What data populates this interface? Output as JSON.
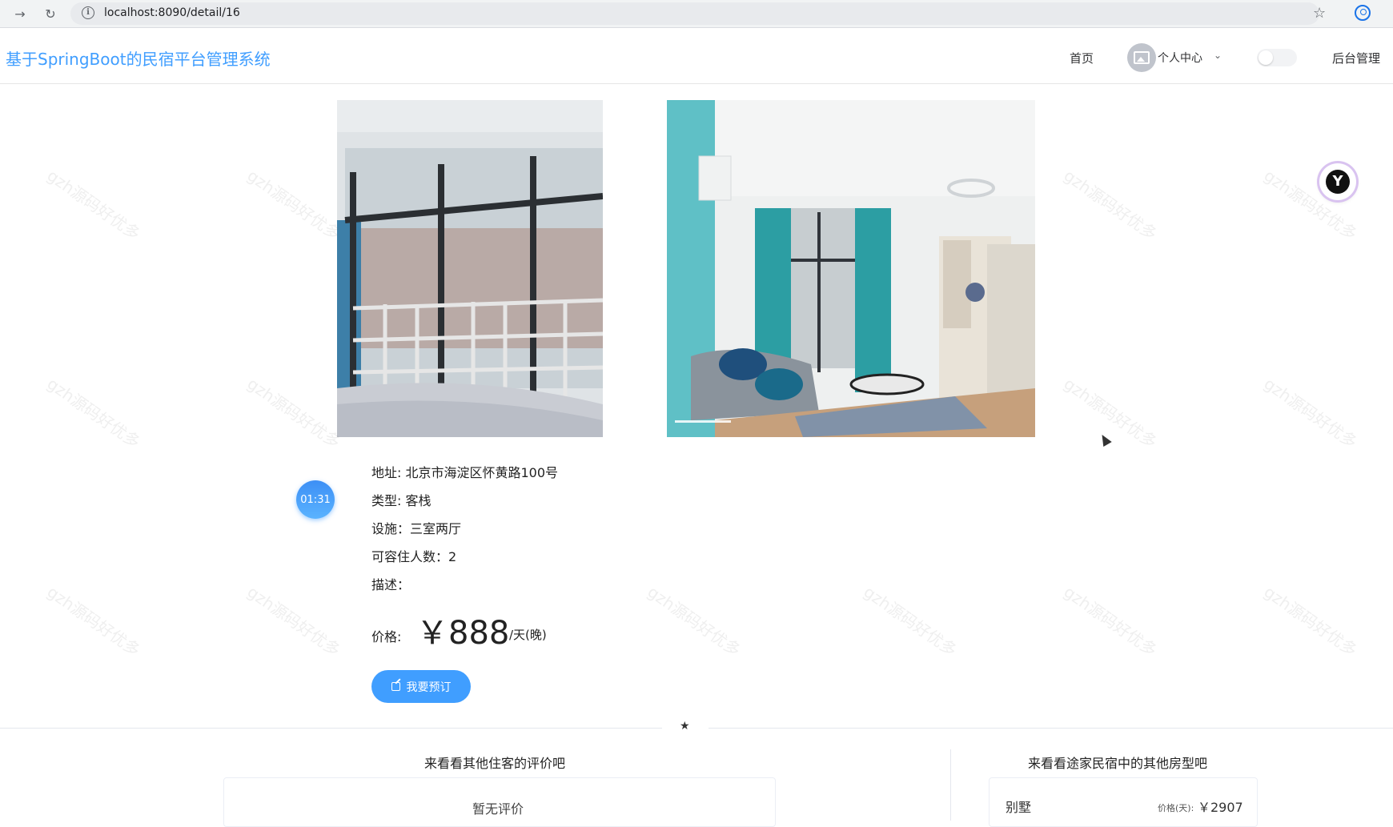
{
  "browser": {
    "url": "localhost:8090/detail/16"
  },
  "header": {
    "title": "基于SpringBoot的民宿平台管理系统",
    "nav": {
      "home": "首页",
      "personal": "个人中心",
      "admin": "后台管理"
    }
  },
  "timer": "01:31",
  "details": {
    "address": "地址: 北京市海淀区怀黄路100号",
    "type": "类型: 客栈",
    "facilities": "设施：三室两厅",
    "capacity": "可容住人数：2",
    "description": "描述：",
    "price_label": "价格:",
    "price_value": "￥888",
    "price_unit": "/天(晚)"
  },
  "actions": {
    "book": "我要预订"
  },
  "reviews": {
    "title": "来看看其他住客的评价吧",
    "empty": "暂无评价"
  },
  "others": {
    "title": "来看看途家民宿中的其他房型吧",
    "items": [
      {
        "name": "别墅",
        "price_label": "价格(天):",
        "price": "￥2907"
      }
    ]
  },
  "watermark": "gzh源码好优多",
  "colors": {
    "accent": "#409eff"
  }
}
